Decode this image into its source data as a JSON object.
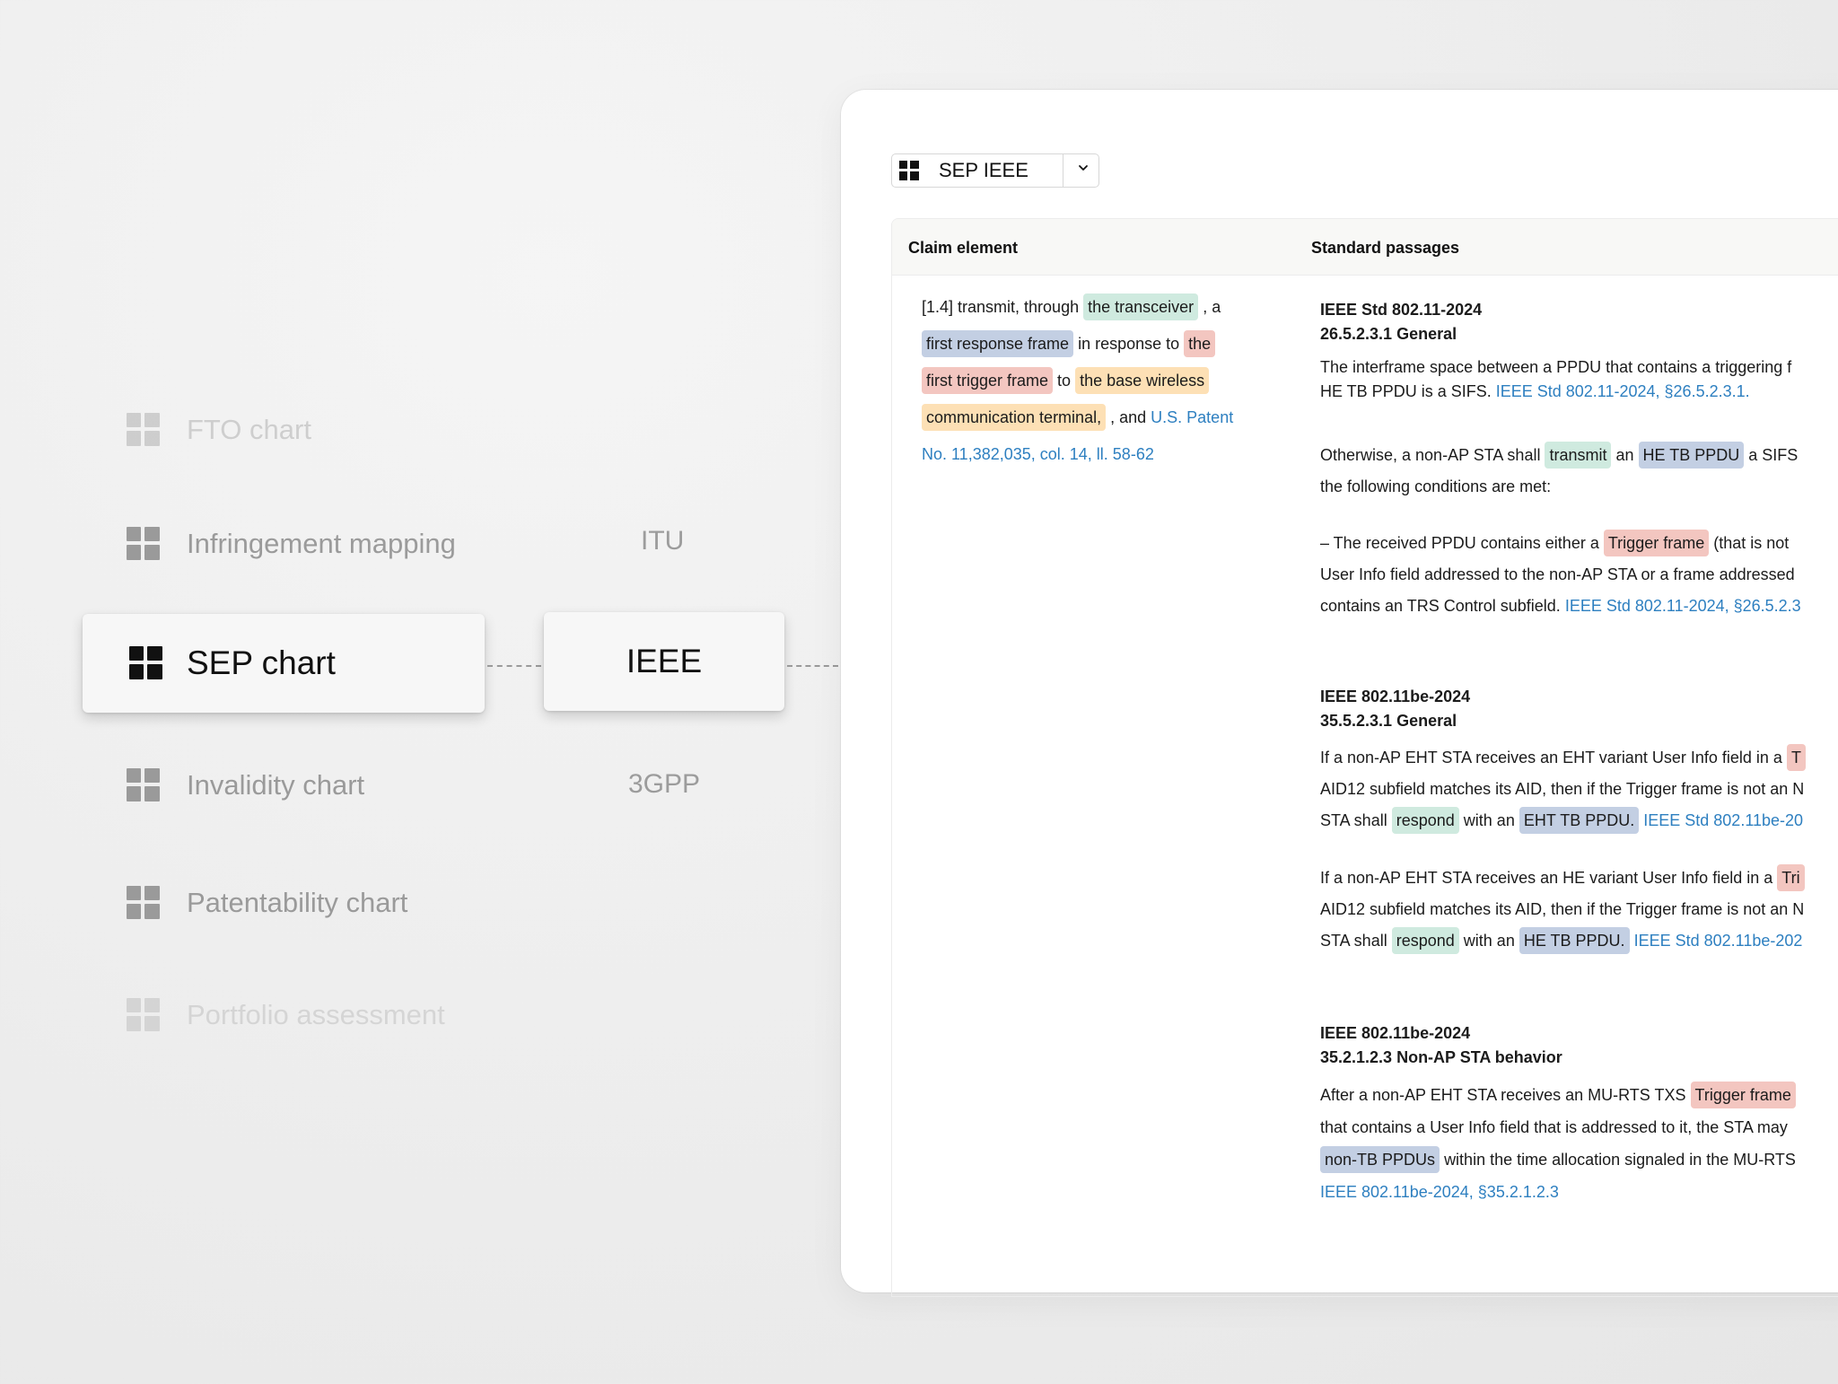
{
  "menu": {
    "items": [
      {
        "label": "FTO chart"
      },
      {
        "label": "Infringement mapping"
      },
      {
        "label": "SEP chart"
      },
      {
        "label": "Invalidity chart"
      },
      {
        "label": "Patentability chart"
      },
      {
        "label": "Portfolio assessment"
      }
    ]
  },
  "standards": {
    "itu": "ITU",
    "ieee": "IEEE",
    "threegpp": "3GPP"
  },
  "panel": {
    "selector_label": "SEP IEEE",
    "columns": {
      "claim": "Claim element",
      "standard": "Standard passages"
    },
    "claim": {
      "p1": "[1.4] transmit, through",
      "h1": "the transceiver",
      "p2": ", a",
      "h2": "first response frame",
      "p3": "in response to",
      "h3a": "the",
      "h3b": "first trigger frame",
      "p4": "to",
      "h4a": "the base wireless",
      "h4b": "communication terminal,",
      "p5": ", and",
      "link_a": "U.S. Patent",
      "link_b": "No. 11,382,035, col. 14, ll. 58-62"
    },
    "sections": [
      {
        "title": "IEEE Std 802.11-2024",
        "subtitle": "26.5.2.3.1 General",
        "para1_text": "The interframe space between a PPDU that contains a triggering f",
        "para1_line2": "HE TB PPDU is a SIFS.",
        "para1_link": "IEEE Std 802.11-2024, §26.5.2.3.1.",
        "para2_a": "Otherwise, a non-AP STA shall",
        "para2_h1": "transmit",
        "para2_b": "an",
        "para2_h2": "HE TB PPDU",
        "para2_c": "a SIFS",
        "para2_line2": "the following conditions are met:",
        "para3_a": "– The received PPDU contains either a",
        "para3_h1": "Trigger frame",
        "para3_b": "(that is not",
        "para3_line2": "User Info field addressed to the non-AP STA or a frame addressed",
        "para3_line3": "contains an TRS Control subfield.",
        "para3_link": "IEEE Std 802.11-2024, §26.5.2.3"
      },
      {
        "title": "IEEE 802.11be-2024",
        "subtitle": "35.5.2.3.1 General",
        "para1_line1": "If a non-AP EHT STA receives an EHT variant User Info field in a",
        "para1_hcut": "T",
        "para1_line2": "AID12 subfield matches its AID, then if the Trigger frame is not an N",
        "para1_a": "STA shall",
        "para1_h1": "respond",
        "para1_b": "with an",
        "para1_h2": "EHT TB PPDU.",
        "para1_link": "IEEE Std 802.11be-20",
        "para2_line1": "If a non-AP EHT STA receives an HE variant User Info field in a",
        "para2_hcut": "Tri",
        "para2_line2": "AID12 subfield matches its AID, then if the Trigger frame is not an N",
        "para2_a": "STA shall",
        "para2_h1": "respond",
        "para2_b": "with an",
        "para2_h2": "HE TB PPDU.",
        "para2_link": "IEEE Std 802.11be-202"
      },
      {
        "title": "IEEE 802.11be-2024",
        "subtitle": "35.2.1.2.3 Non-AP STA behavior",
        "para1_a": "After a non-AP EHT STA receives an MU-RTS TXS",
        "para1_h1": "Trigger frame",
        "para1_line2": "that contains a User Info field that is addressed to it, the STA may",
        "para1_h2": "non-TB PPDUs",
        "para1_b": "within the time allocation signaled in the MU-RTS",
        "para1_link": "IEEE 802.11be-2024, §35.2.1.2.3"
      }
    ]
  },
  "colors": {
    "highlight_green": "#cfeadf",
    "highlight_blue": "#c3cfe3",
    "highlight_red": "#f3c6c0",
    "highlight_orange": "#fde0b5",
    "link": "#2d7fc0"
  }
}
